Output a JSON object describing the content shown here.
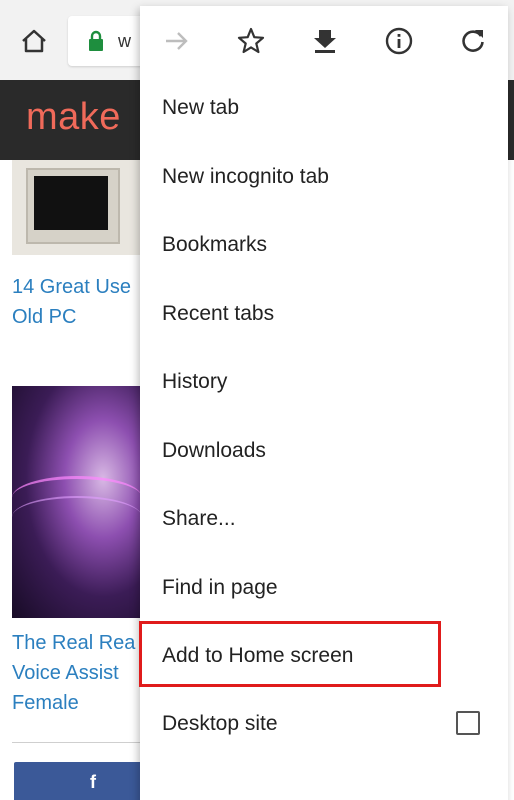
{
  "browser": {
    "url_fragment": "w",
    "icons": {
      "home": "home-icon",
      "lock": "lock-icon",
      "forward": "arrow-forward-icon",
      "bookmark": "star-icon",
      "download": "download-icon",
      "info": "info-icon",
      "reload": "reload-icon"
    },
    "colors": {
      "toolbar": "#f2f2f2",
      "lock": "#1e8e3e",
      "highlight": "#e01b1b"
    }
  },
  "site": {
    "logo_text": "make",
    "logo_color": "#f06a5a",
    "header_color": "#2a2a2a"
  },
  "articles": [
    {
      "title": "14 Great Use\nOld PC"
    },
    {
      "title": "The Real Rea\nVoice Assist\nFemale"
    }
  ],
  "share": {
    "facebook_label": "f",
    "facebook_color": "#3b5998",
    "twitter_color": "#1da1f2"
  },
  "menu": {
    "items": [
      {
        "label": "New tab"
      },
      {
        "label": "New incognito tab"
      },
      {
        "label": "Bookmarks"
      },
      {
        "label": "Recent tabs"
      },
      {
        "label": "History"
      },
      {
        "label": "Downloads"
      },
      {
        "label": "Share..."
      },
      {
        "label": "Find in page"
      },
      {
        "label": "Add to Home screen",
        "highlighted": true
      },
      {
        "label": "Desktop site",
        "checkbox": false
      }
    ]
  }
}
